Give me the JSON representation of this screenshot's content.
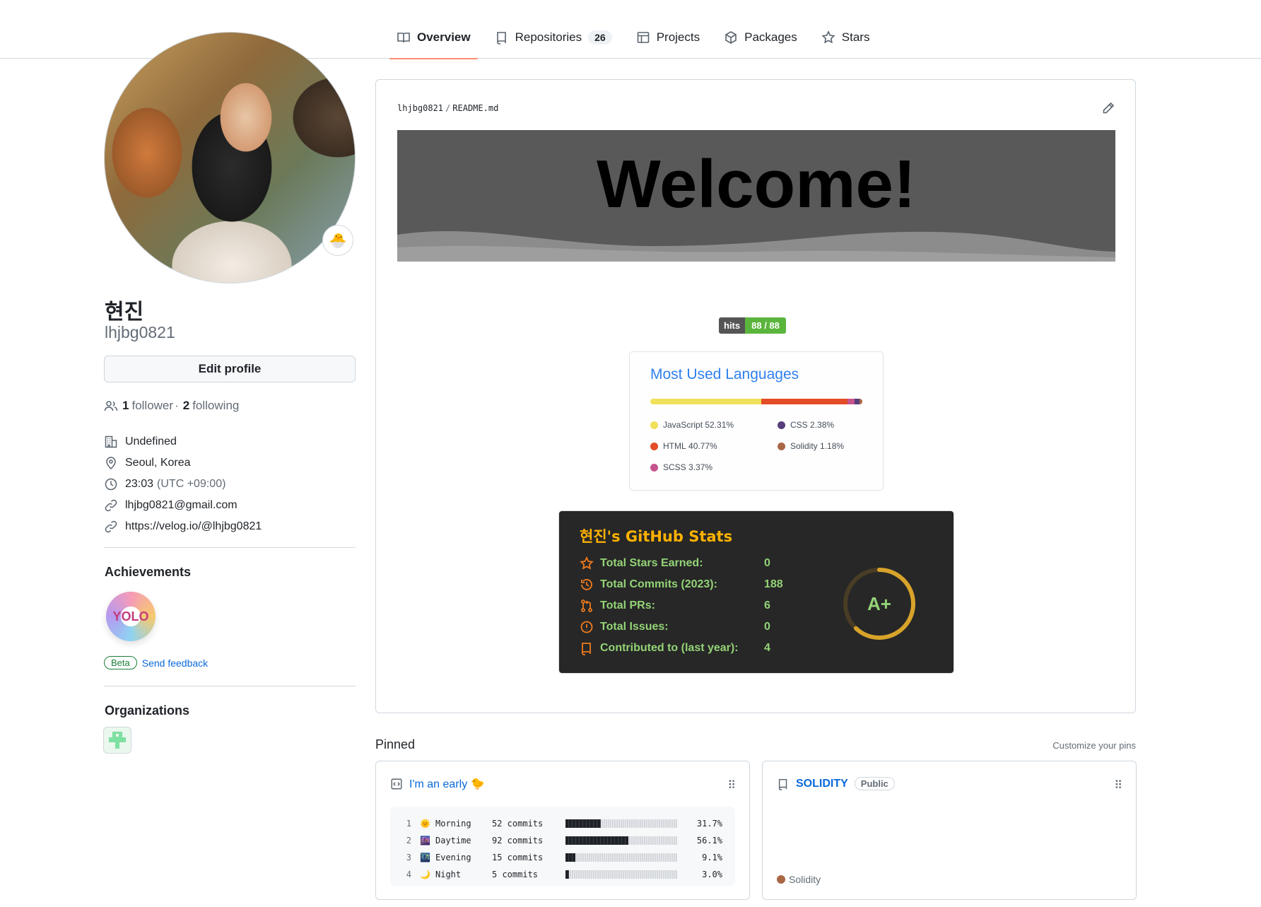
{
  "tabs": [
    {
      "label": "Overview",
      "icon": "book-icon"
    },
    {
      "label": "Repositories",
      "icon": "repo-icon",
      "count": "26"
    },
    {
      "label": "Projects",
      "icon": "table-icon"
    },
    {
      "label": "Packages",
      "icon": "package-icon"
    },
    {
      "label": "Stars",
      "icon": "star-icon"
    }
  ],
  "profile": {
    "name": "현진",
    "login": "lhjbg0821",
    "status_emoji": "🐣",
    "edit_label": "Edit profile",
    "followers": "1",
    "followers_label": "follower",
    "following": "2",
    "following_label": "following",
    "dot": "·",
    "company": "Undefined",
    "location": "Seoul, Korea",
    "time": "23:03",
    "timezone": "(UTC +09:00)",
    "email": "lhjbg0821@gmail.com",
    "website": "https://velog.io/@lhjbg0821"
  },
  "achievements": {
    "title": "Achievements",
    "badge_text": "YOLO",
    "beta": "Beta",
    "feedback": "Send feedback"
  },
  "organizations": {
    "title": "Organizations"
  },
  "readme": {
    "owner": "lhjbg0821",
    "sep": "/",
    "file": "README.md",
    "banner_title": "Welcome!",
    "hits_label": "hits",
    "hits_value": "88 / 88"
  },
  "languages_card": {
    "title": "Most Used Languages",
    "items": [
      {
        "name": "JavaScript",
        "pct": "52.31%",
        "value": 52.31,
        "color": "#f1e05a"
      },
      {
        "name": "HTML",
        "pct": "40.77%",
        "value": 40.77,
        "color": "#e34c26"
      },
      {
        "name": "SCSS",
        "pct": "3.37%",
        "value": 3.37,
        "color": "#c6538c"
      },
      {
        "name": "CSS",
        "pct": "2.38%",
        "value": 2.38,
        "color": "#563d7c"
      },
      {
        "name": "Solidity",
        "pct": "1.18%",
        "value": 1.18,
        "color": "#aa6746"
      }
    ]
  },
  "stats_card": {
    "title": "현진's GitHub Stats",
    "rows": [
      {
        "label": "Total Stars Earned:",
        "value": "0"
      },
      {
        "label": "Total Commits (2023):",
        "value": "188"
      },
      {
        "label": "Total PRs:",
        "value": "6"
      },
      {
        "label": "Total Issues:",
        "value": "0"
      },
      {
        "label": "Contributed to (last year):",
        "value": "4"
      }
    ],
    "grade": "A+",
    "grade_progress": 0.62
  },
  "pinned": {
    "title": "Pinned",
    "customize": "Customize your pins",
    "gist": {
      "title": "I'm an early 🐤",
      "rows": [
        {
          "num": "1",
          "emoji": "🌞",
          "name": "Morning",
          "commits": "52 commits",
          "pct": "31.7%",
          "value": 31.7
        },
        {
          "num": "2",
          "emoji": "🌆",
          "name": "Daytime",
          "commits": "92 commits",
          "pct": "56.1%",
          "value": 56.1
        },
        {
          "num": "3",
          "emoji": "🌃",
          "name": "Evening",
          "commits": "15 commits",
          "pct": "9.1%",
          "value": 9.1
        },
        {
          "num": "4",
          "emoji": "🌙",
          "name": "Night",
          "commits": "5 commits",
          "pct": "3.0%",
          "value": 3.0
        }
      ]
    },
    "repo": {
      "title": "SOLIDITY",
      "visibility": "Public",
      "language": "Solidity",
      "language_color": "#aa6746"
    }
  }
}
